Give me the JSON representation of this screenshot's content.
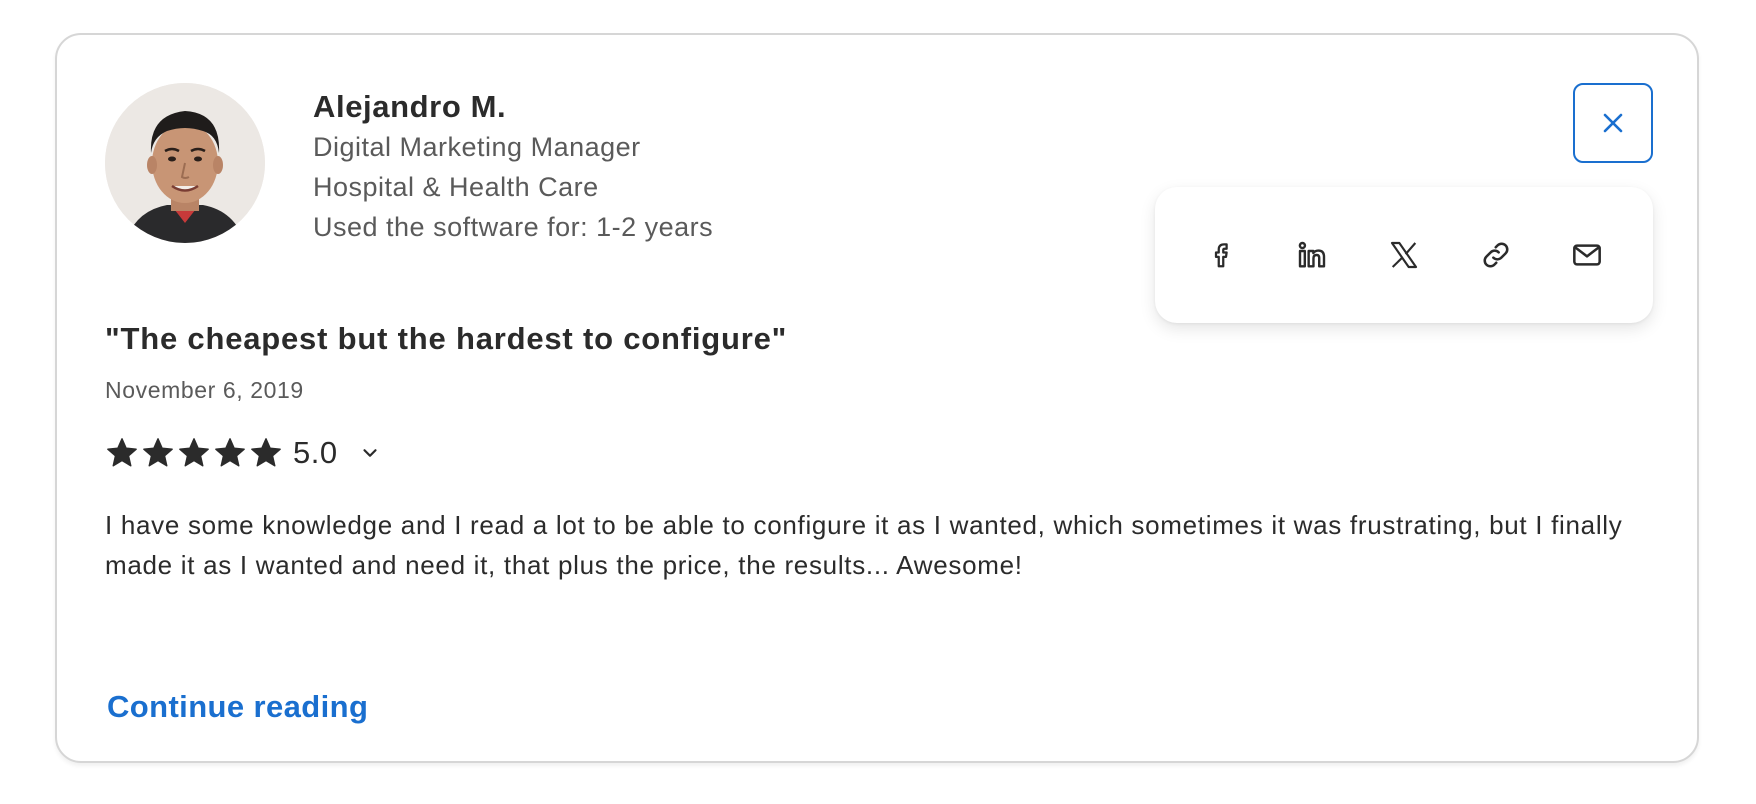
{
  "reviewer": {
    "name": "Alejandro M.",
    "job_title": "Digital Marketing Manager",
    "industry": "Hospital & Health Care",
    "usage": "Used the software for: 1-2 years",
    "avatar_icon": "reviewer-photo"
  },
  "close_button": {
    "icon": "close-icon",
    "color": "#1a6fcf"
  },
  "share": {
    "items": [
      {
        "name": "facebook",
        "icon": "facebook-icon"
      },
      {
        "name": "linkedin",
        "icon": "linkedin-icon"
      },
      {
        "name": "x",
        "icon": "x-icon"
      },
      {
        "name": "copy-link",
        "icon": "link-icon"
      },
      {
        "name": "email",
        "icon": "mail-icon"
      }
    ]
  },
  "review": {
    "title": "\"The cheapest but the hardest to configure\"",
    "date": "November 6, 2019",
    "rating": "5.0",
    "stars_filled": 5,
    "stars_total": 5,
    "body": "I have some knowledge and I read a lot to be able to configure it as I wanted, which sometimes it was frustrating, but I finally made it as I wanted and need it, that plus the price, the results... Awesome!",
    "continue_label": "Continue reading"
  },
  "colors": {
    "accent": "#1a6fcf",
    "text_primary": "#2b2b2b",
    "text_secondary": "#5a5a5a",
    "card_border": "#d6d6d6"
  }
}
